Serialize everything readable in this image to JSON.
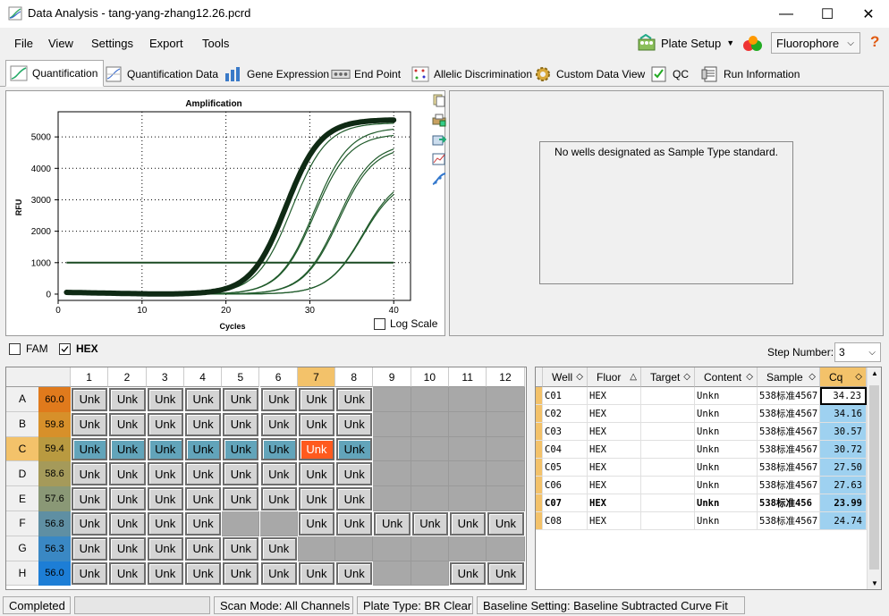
{
  "window": {
    "title": "Data Analysis - tang-yang-zhang12.26.pcrd",
    "minimize": "—",
    "maximize": "☐",
    "close": "✕"
  },
  "menu": [
    "File",
    "View",
    "Settings",
    "Export",
    "Tools"
  ],
  "toolbar": {
    "plate_setup": "Plate Setup",
    "fluorophore": "Fluorophore",
    "help": "?"
  },
  "tabs": [
    "Quantification",
    "Quantification Data",
    "Gene Expression",
    "End Point",
    "Allelic Discrimination",
    "Custom Data View",
    "QC",
    "Run Information"
  ],
  "chart": {
    "title": "Amplification",
    "xlabel": "Cycles",
    "ylabel": "RFU",
    "log_scale": "Log Scale"
  },
  "chart_data": {
    "type": "line",
    "title": "Amplification",
    "xlabel": "Cycles",
    "ylabel": "RFU",
    "xlim": [
      0,
      42
    ],
    "ylim": [
      -200,
      5800
    ],
    "xticks": [
      "0",
      "10",
      "20",
      "30",
      "40"
    ],
    "yticks": [
      "0",
      "1000",
      "2000",
      "3000",
      "4000",
      "5000"
    ],
    "threshold": 1000,
    "grid": true,
    "series_ct": [
      23.99,
      24.74,
      27.5,
      27.63,
      30.57,
      30.72,
      34.16,
      34.23
    ],
    "series_final": [
      5550,
      5450,
      5300,
      5100,
      4800,
      4700,
      3800,
      3700
    ],
    "highlight": "C07"
  },
  "standard_panel": {
    "message": "No wells designated as Sample Type standard."
  },
  "fluor_checks": {
    "fam": "FAM",
    "hex": "HEX",
    "step_label": "Step Number:",
    "step_value": "3"
  },
  "plate": {
    "columns": [
      "1",
      "2",
      "3",
      "4",
      "5",
      "6",
      "7",
      "8",
      "9",
      "10",
      "11",
      "12"
    ],
    "rows": [
      {
        "label": "A",
        "temp": "60.0",
        "color": "#e07a1c",
        "wells": [
          1,
          1,
          1,
          1,
          1,
          1,
          1,
          1,
          0,
          0,
          0,
          0
        ]
      },
      {
        "label": "B",
        "temp": "59.8",
        "color": "#d7902a",
        "wells": [
          1,
          1,
          1,
          1,
          1,
          1,
          1,
          1,
          0,
          0,
          0,
          0
        ]
      },
      {
        "label": "C",
        "temp": "59.4",
        "color": "#b99a40",
        "wells": [
          2,
          2,
          2,
          2,
          2,
          2,
          3,
          2,
          0,
          0,
          0,
          0
        ]
      },
      {
        "label": "D",
        "temp": "58.6",
        "color": "#a59a5a",
        "wells": [
          1,
          1,
          1,
          1,
          1,
          1,
          1,
          1,
          0,
          0,
          0,
          0
        ]
      },
      {
        "label": "E",
        "temp": "57.6",
        "color": "#8a9876",
        "wells": [
          1,
          1,
          1,
          1,
          1,
          1,
          1,
          1,
          0,
          0,
          0,
          0
        ]
      },
      {
        "label": "F",
        "temp": "56.8",
        "color": "#5f8fa3",
        "wells": [
          1,
          1,
          1,
          1,
          0,
          0,
          1,
          1,
          1,
          1,
          1,
          1
        ]
      },
      {
        "label": "G",
        "temp": "56.3",
        "color": "#3a88c4",
        "wells": [
          1,
          1,
          1,
          1,
          1,
          1,
          0,
          0,
          0,
          0,
          0,
          0
        ]
      },
      {
        "label": "H",
        "temp": "56.0",
        "color": "#1d7ed6",
        "wells": [
          1,
          1,
          1,
          1,
          1,
          1,
          1,
          1,
          0,
          0,
          1,
          1
        ]
      }
    ],
    "well_label": "Unk"
  },
  "table": {
    "headers": [
      "Well",
      "Fluor",
      "Target",
      "Content",
      "Sample",
      "Cq"
    ],
    "rows": [
      [
        "C01",
        "HEX",
        "",
        "Unkn",
        "538标准4567",
        "34.23"
      ],
      [
        "C02",
        "HEX",
        "",
        "Unkn",
        "538标准4567",
        "34.16"
      ],
      [
        "C03",
        "HEX",
        "",
        "Unkn",
        "538标准4567",
        "30.57"
      ],
      [
        "C04",
        "HEX",
        "",
        "Unkn",
        "538标准4567",
        "30.72"
      ],
      [
        "C05",
        "HEX",
        "",
        "Unkn",
        "538标准4567",
        "27.50"
      ],
      [
        "C06",
        "HEX",
        "",
        "Unkn",
        "538标准4567",
        "27.63"
      ],
      [
        "C07",
        "HEX",
        "",
        "Unkn",
        "538标准456",
        "23.99"
      ],
      [
        "C08",
        "HEX",
        "",
        "Unkn",
        "538标准4567",
        "24.74"
      ]
    ],
    "selected_row": 6
  },
  "status": {
    "state": "Completed",
    "scan_mode": "Scan Mode: All Channels",
    "plate_type": "Plate Type: BR Clear",
    "baseline": "Baseline Setting: Baseline Subtracted Curve Fit"
  },
  "colors": {
    "unk_blue": "#62a4ba",
    "unk_selected": "#ff5a1e",
    "cq_cell": "#9ed1f0"
  }
}
